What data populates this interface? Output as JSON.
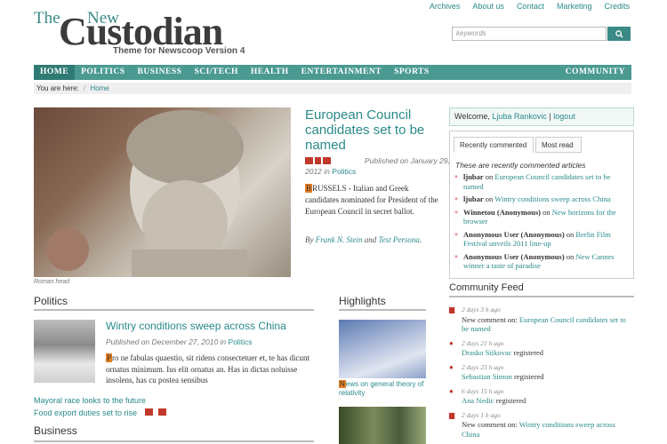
{
  "header": {
    "logo_the": "The",
    "logo_new": "New",
    "logo_main": "Custodian",
    "tagline": "Theme for Newscoop Version 4",
    "toplinks": [
      "Archives",
      "About us",
      "Contact",
      "Marketing",
      "Credits"
    ],
    "search_placeholder": "keywords"
  },
  "nav": {
    "items": [
      "HOME",
      "POLITICS",
      "BUSINESS",
      "SCI/TECH",
      "HEALTH",
      "ENTERTAINMENT",
      "SPORTS"
    ],
    "community": "COMMUNITY"
  },
  "breadcrumb": {
    "label": "You are here:",
    "sep": "/",
    "home": "Home"
  },
  "lead": {
    "caption": "Roman head",
    "title": "European Council candidates set to be named",
    "published": "Published on January 29,",
    "published2": "2012",
    "in": "in",
    "section": "Politics",
    "dropcap": "B",
    "text": "RUSSELS - Italian and Greek candidates nominated for President of the European Council in secret ballot.",
    "by": "By",
    "author1": "Frank N. Stein",
    "and": "and",
    "author2": "Test Persona",
    "period": "."
  },
  "politics": {
    "title": "Politics",
    "article_title": "Wintry conditions sweep across China",
    "meta": "Published on December 27, 2010 in",
    "meta_section": "Politics",
    "dropcap": "P",
    "text": "ro ne fabulas quaestio, sit ridens consectetuer et, te has dicunt ornatus minimum. Ius elit ornatus an. Has in dictas noluisse insolens, has cu postea sensibus",
    "links": [
      "Mayoral race looks to the future",
      "Food export duties set to rise"
    ]
  },
  "highlights": {
    "title": "Highlights",
    "dropcap": "N",
    "text": "ews on general theory of relativity"
  },
  "business": {
    "title": "Business"
  },
  "welcome": {
    "label": "Welcome,",
    "user": "Ljuba Rankovic",
    "sep": "|",
    "logout": "logout"
  },
  "tabs": {
    "recent": "Recently commented",
    "most": "Most read"
  },
  "recent": {
    "note": "These are recently commented articles",
    "items": [
      {
        "user": "ljubar",
        "on": "on",
        "article": "European Council candidates set to be named"
      },
      {
        "user": "ljubar",
        "on": "on",
        "article": "Wintry conditions sweep across China"
      },
      {
        "user": "Winnetou (Anonymous)",
        "on": "on",
        "article": "New horizons for the browser"
      },
      {
        "user": "Anonymous User (Anonymous)",
        "on": "on",
        "article": "Berlin Film Festival unveils 2011 line-up"
      },
      {
        "user": "Anonymous User (Anonymous)",
        "on": "on",
        "article": "New Cannes winner a taste of paradise"
      }
    ]
  },
  "feed": {
    "title": "Community Feed",
    "items": [
      {
        "time": "2 days 3 h ago",
        "text": "New comment on:",
        "link": "European Council candidates set to be named",
        "type": "comment"
      },
      {
        "time": "2 days 21 h ago",
        "link": "Drasko Stikovac",
        "text": "registered",
        "type": "user"
      },
      {
        "time": "2 days 23 h ago",
        "link": "Sebastian Simon",
        "text": "registered",
        "type": "user"
      },
      {
        "time": "6 days 15 h ago",
        "link": "Ana Nedic",
        "text": "registered",
        "type": "user"
      },
      {
        "time": "2 days 1 h ago",
        "text": "New comment on:",
        "link": "Wintry conditions sweep across China",
        "type": "comment"
      }
    ]
  },
  "colors": {
    "accent": "#2a8a8a",
    "nav": "#4a9a92",
    "nav_active": "#2f7a74",
    "media_icon": "#c0392b",
    "dropcap": "#e67e22"
  }
}
